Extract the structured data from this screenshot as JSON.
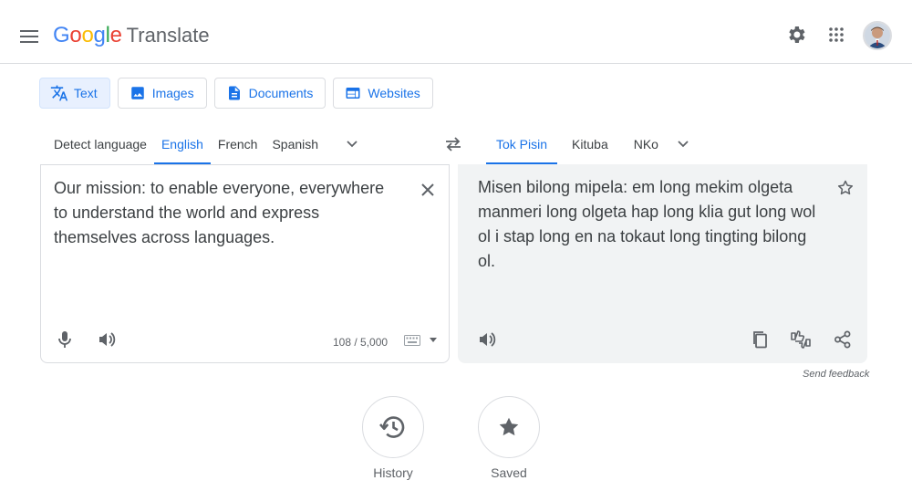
{
  "header": {
    "logo_google": "Google",
    "logo_product": "Translate"
  },
  "modes": [
    {
      "label": "Text",
      "icon": "translate-icon",
      "active": true
    },
    {
      "label": "Images",
      "icon": "image-icon",
      "active": false
    },
    {
      "label": "Documents",
      "icon": "document-icon",
      "active": false
    },
    {
      "label": "Websites",
      "icon": "website-icon",
      "active": false
    }
  ],
  "source_langs": {
    "detect": "Detect language",
    "items": [
      "English",
      "French",
      "Spanish"
    ],
    "active": "English"
  },
  "target_langs": {
    "items": [
      "Tok Pisin",
      "Kituba",
      "NKo"
    ],
    "active": "Tok Pisin"
  },
  "source": {
    "text": "Our mission: to enable everyone, everywhere to understand the world and express themselves across languages.",
    "char_count": "108 / 5,000"
  },
  "target": {
    "text": "Misen bilong mipela: em long mekim olgeta manmeri long olgeta hap long klia gut long wol ol i stap long en na tokaut long tingting bilong ol."
  },
  "feedback": "Send feedback",
  "bottom": {
    "history_label": "History",
    "saved_label": "Saved"
  },
  "colors": {
    "accent": "#1a73e8",
    "google_blue": "#4285F4",
    "google_red": "#EA4335",
    "google_yellow": "#FBBC05",
    "google_green": "#34A853"
  }
}
